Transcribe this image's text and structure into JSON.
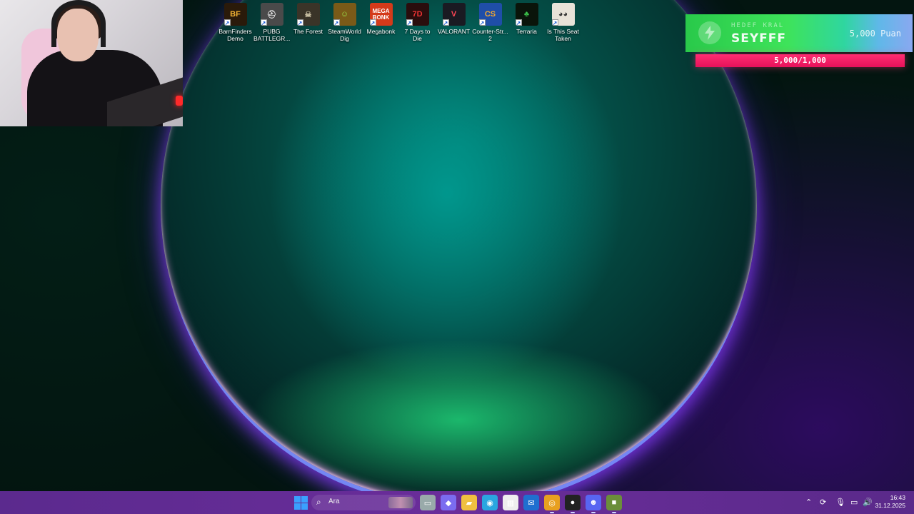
{
  "desktop_icons": [
    {
      "label": "BarnFinders Demo",
      "glyph": "BF",
      "color": "#2a1a0a",
      "text_color": "#f2b233",
      "icon": "barnfinders-icon"
    },
    {
      "label": "PUBG BATTLEGR...",
      "glyph": "⛑",
      "color": "#4a4a4a",
      "text_color": "#ddd",
      "icon": "pubg-icon"
    },
    {
      "label": "The Forest",
      "glyph": "☠",
      "color": "#3a3428",
      "text_color": "#cfc6a8",
      "icon": "the-forest-icon"
    },
    {
      "label": "SteamWorld Dig",
      "glyph": "☺",
      "color": "#7a5a18",
      "text_color": "#9be04a",
      "icon": "steamworld-dig-icon"
    },
    {
      "label": "Megabonk",
      "glyph": "MEGA BONK",
      "color": "#d43a1a",
      "text_color": "#fff",
      "icon": "megabonk-icon"
    },
    {
      "label": "7 Days to Die",
      "glyph": "7D",
      "color": "#2a0d0d",
      "text_color": "#e33",
      "icon": "7-days-to-die-icon"
    },
    {
      "label": "VALORANT",
      "glyph": "V",
      "color": "#1a1a22",
      "text_color": "#ff4655",
      "icon": "valorant-icon"
    },
    {
      "label": "Counter-Str... 2",
      "glyph": "CS",
      "color": "#1f4ea8",
      "text_color": "#f0a830",
      "icon": "counter-strike-2-icon"
    },
    {
      "label": "Terraria",
      "glyph": "♣",
      "color": "#0a140a",
      "text_color": "#3cc24a",
      "icon": "terraria-icon"
    },
    {
      "label": "Is This Seat Taken",
      "glyph": "◕◕",
      "color": "#e8e2d8",
      "text_color": "#333",
      "icon": "is-this-seat-taken-icon"
    }
  ],
  "alert": {
    "kicker": "HEDEF KRAL",
    "name": "SEYFFF",
    "points": "5,000 Puan",
    "progress_text": "5,000/1,000",
    "progress_fraction": 1.0
  },
  "taskbar": {
    "search_placeholder": "Ara",
    "apps": [
      {
        "name": "task-view-icon",
        "glyph": "▭",
        "color": "#9aa"
      },
      {
        "name": "m365-copilot-icon",
        "glyph": "◆",
        "color": "#7b6cf0"
      },
      {
        "name": "file-explorer-icon",
        "glyph": "▰",
        "color": "#f0c040"
      },
      {
        "name": "edge-icon",
        "glyph": "◉",
        "color": "#2aa6e0"
      },
      {
        "name": "microsoft-store-icon",
        "glyph": "▦",
        "color": "#eee"
      },
      {
        "name": "outlook-icon",
        "glyph": "✉",
        "color": "#1f6fd0"
      },
      {
        "name": "chrome-icon",
        "glyph": "◎",
        "color": "#e8a020",
        "running": true
      },
      {
        "name": "obs-icon",
        "glyph": "●",
        "color": "#222",
        "running": true
      },
      {
        "name": "discord-icon",
        "glyph": "☻",
        "color": "#5865f2",
        "running": true
      },
      {
        "name": "minecraft-icon",
        "glyph": "■",
        "color": "#6b8e3a",
        "running": true
      }
    ]
  },
  "tray": {
    "time": "16:43",
    "date": "31.12.2025"
  }
}
